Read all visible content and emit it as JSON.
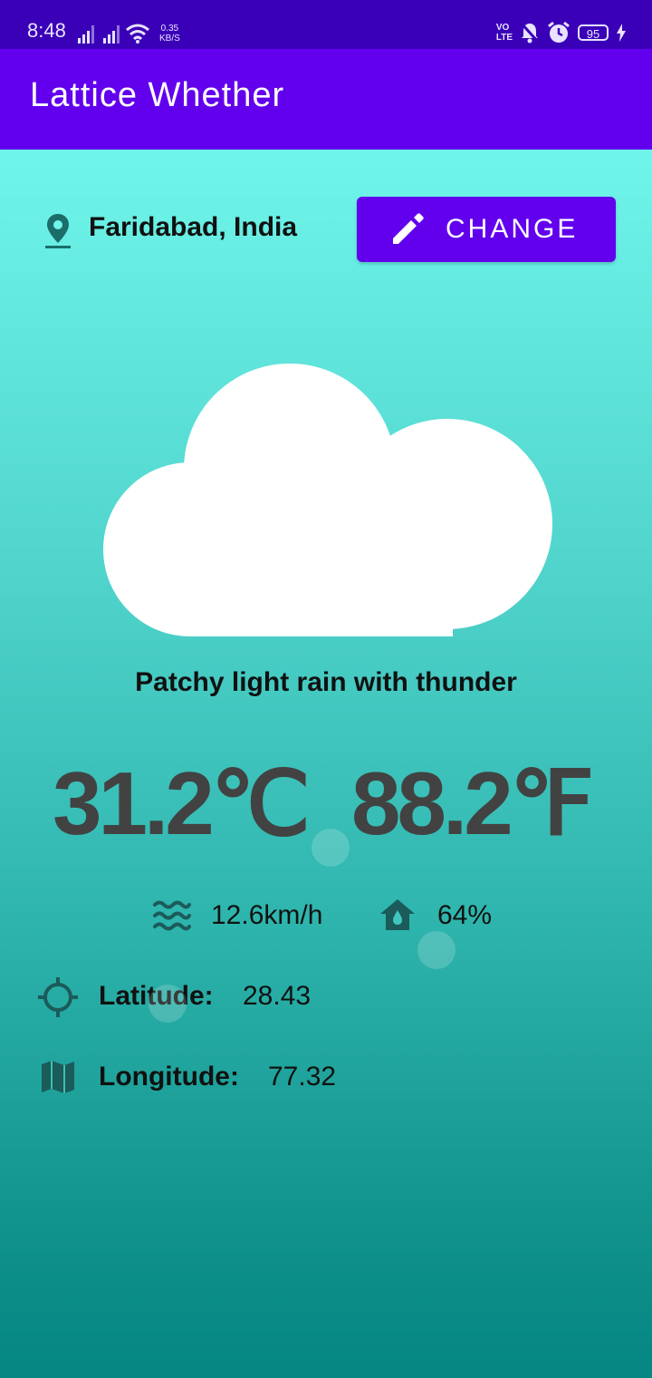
{
  "status_bar": {
    "time": "8:48",
    "speed_value": "0.35",
    "speed_unit": "KB/S",
    "volte_top": "VO",
    "volte_bottom": "LTE",
    "battery": "95",
    "icons": [
      "signal-icon",
      "signal-icon",
      "wifi-icon",
      "volte-icon",
      "mute-bell-icon",
      "alarm-icon",
      "battery-icon",
      "charging-icon"
    ]
  },
  "app_bar": {
    "title": "Lattice Whether"
  },
  "location": {
    "icon": "location-pin-icon",
    "text": "Faridabad, India"
  },
  "change_button": {
    "icon": "pencil-icon",
    "label": "CHANGE"
  },
  "weather": {
    "icon": "cloud-icon",
    "description": "Patchy light rain with thunder",
    "temp_c": "31.2℃",
    "temp_f": "88.2℉"
  },
  "wind": {
    "icon": "wind-waves-icon",
    "value": "12.6km/h"
  },
  "humidity": {
    "icon": "home-drop-icon",
    "value": "64%"
  },
  "latitude": {
    "icon": "crosshair-icon",
    "label": "Latitude:",
    "value": "28.43"
  },
  "longitude": {
    "icon": "map-icon",
    "label": "Longitude:",
    "value": "77.32"
  },
  "colors": {
    "status_bar": "#3a00b8",
    "app_bar": "#6200ee",
    "button": "#6200ee",
    "icon_dark_teal": "#1b5b5a",
    "temperature_text": "#424242"
  }
}
